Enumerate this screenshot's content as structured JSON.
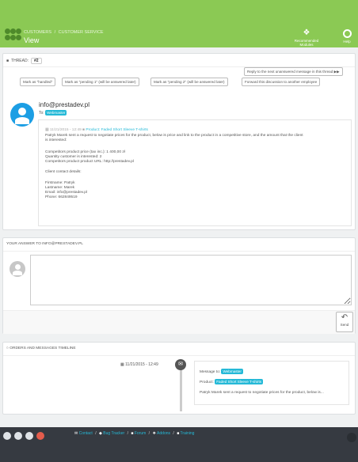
{
  "colors": {
    "header": "#8bc954",
    "accent": "#25b9d7",
    "footer": "#363a41"
  },
  "header": {
    "breadcrumb": [
      "CUSTOMERS",
      "CUSTOMER SERVICE"
    ],
    "breadcrumb_sep": "/",
    "title": "View",
    "toolbar": [
      {
        "label": "Recommended Modules",
        "icon": "puzzle-icon"
      },
      {
        "label": "Help",
        "icon": "help-ring-icon"
      }
    ]
  },
  "thread": {
    "label": "THREAD:",
    "number": "#2",
    "reply_next": "Reply to the next unanswered message in this thread",
    "actions": [
      "Mark as \"handled\"",
      "Mark as \"pending 1\" (will be answered later)",
      "Mark as \"pending 2\" (will be answered later)",
      "Forward this discussion to another employee"
    ],
    "from": "info@prestadev.pl",
    "to_label": "To:",
    "to_tag": "Webmaster",
    "meta_date": "11/21/2015 - 12:49",
    "meta_product": "Product: Faded Short Sleeve T-shirts",
    "message_lines": [
      "Patryk Marek sent a request to negotiate prices for the product, below is price and link to the product in a competitive store, and the amount that the client",
      "is interested:",
      "",
      "Competitors product price (tax inc.): 1 400,00 zł",
      "Quantity customer is interested: 2",
      "Competitors product product URL: http://prestadev.pl",
      "",
      "Client contact details:",
      "",
      "Firstname: Patryk",
      "Lastname: Marek",
      "Email: info@prestadev.pl",
      "Phone: 662849519"
    ]
  },
  "answer": {
    "title": "YOUR ANSWER TO INFO@PRESTADEV.PL",
    "textarea_value": "",
    "send_label": "Send"
  },
  "timeline": {
    "title": "ORDERS AND MESSAGES TIMELINE",
    "date": "11/21/2015 - 12:49",
    "message_to_label": "Message to:",
    "message_to_tag": "Webmaster",
    "product_label": "Product:",
    "product_tag": "Faded Short Sleeve T-shirts",
    "excerpt": "Patryk Marek sent a request to negotiate prices for the product, below is..."
  },
  "footer": {
    "social_icons": [
      "twitter-icon",
      "facebook-icon",
      "github-icon",
      "google-plus-icon"
    ],
    "links": [
      "Contact",
      "Bug Tracker",
      "Forum",
      "Addons",
      "Training"
    ],
    "link_sep": "/"
  }
}
